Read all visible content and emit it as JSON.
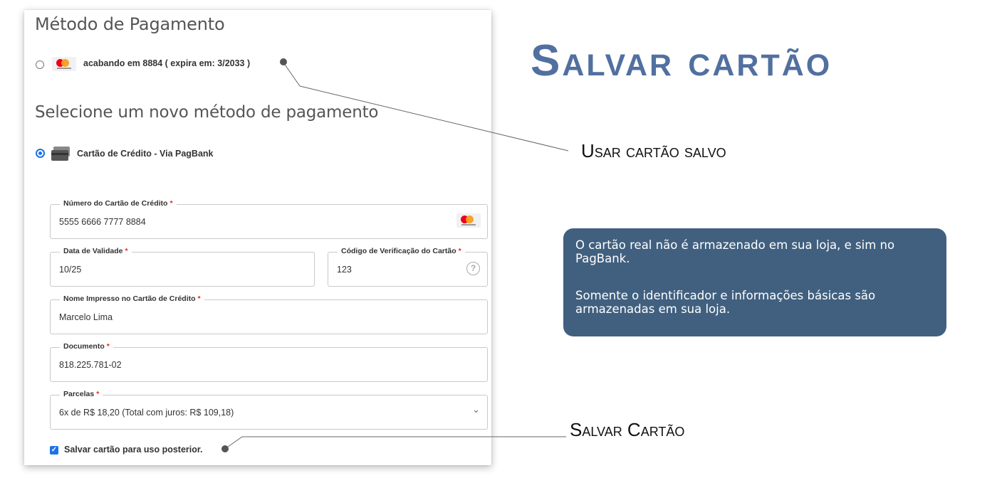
{
  "payment": {
    "title": "Método de Pagamento",
    "saved_card": {
      "label": "acabando em 8884 ( expira em: 3/2033 )",
      "brand_icon": "mastercard-icon",
      "selected": false
    },
    "new_method_title": "Selecione um novo método de pagamento",
    "credit_card_option": {
      "label": "Cartão de Crédito - Via PagBank",
      "icon": "credit-card-icon",
      "selected": true
    },
    "form": {
      "card_number": {
        "label": "Número do Cartão de Crédito",
        "required": "*",
        "value": "5555 6666 7777 8884"
      },
      "expiry": {
        "label": "Data de Validade",
        "required": "*",
        "value": "10/25"
      },
      "cvv": {
        "label": "Código de Verificação do Cartão",
        "required": "*",
        "value": "123",
        "help": "?"
      },
      "holder": {
        "label": "Nome Impresso no Cartão de Crédito",
        "required": "*",
        "value": "Marcelo Lima"
      },
      "document": {
        "label": "Documento",
        "required": "*",
        "value": "818.225.781-02"
      },
      "installments": {
        "label": "Parcelas",
        "required": "*",
        "value": "6x de R$ 18,20 (Total com juros: R$ 109,18)"
      }
    },
    "save_card": {
      "label": "Salvar cartão para uso posterior.",
      "checked": true,
      "check": "✓"
    }
  },
  "annotation": {
    "title": "Salvar cartão",
    "use_saved": "Usar cartão salvo",
    "save_card": "Salvar Cartão",
    "info": {
      "p1": "O cartão real não é armazenado em sua loja, e sim no PagBank.",
      "p2": "Somente o identificador e informações básicas são armazenadas em sua loja."
    }
  },
  "colors": {
    "accent": "#1a73e8",
    "title": "#5170a0",
    "info_bg": "#41607f",
    "required": "#e02b27"
  }
}
